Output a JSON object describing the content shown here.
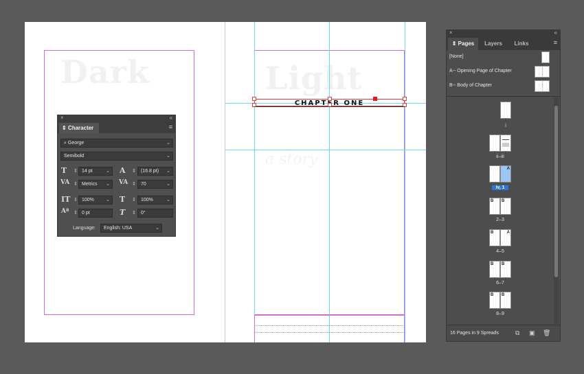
{
  "document": {
    "frame_text": "CHAPTER ONE",
    "ghost_heading_left": "Dark",
    "ghost_heading_right": "Light",
    "ghost_subheading": "a story"
  },
  "character_panel": {
    "tab_label": "Character",
    "font_family": "George",
    "font_style": "Semibold",
    "font_size": "14 pt",
    "leading": "(16.8 pt)",
    "kerning": "Metrics",
    "tracking": "70",
    "vertical_scale": "100%",
    "horizontal_scale": "100%",
    "baseline_shift": "0 pt",
    "skew": "0°",
    "language_label": "Language:",
    "language_value": "English: USA"
  },
  "pages_panel": {
    "tabs": [
      "Pages",
      "Layers",
      "Links"
    ],
    "masters": [
      {
        "label": "[None]"
      },
      {
        "label": "A-- Opening Page of Chapter"
      },
      {
        "label": "B-- Body of Chapter"
      }
    ],
    "spreads": [
      {
        "label": "i",
        "letters": [
          "",
          ""
        ]
      },
      {
        "label": "ii–iii",
        "letters": [
          "",
          ""
        ]
      },
      {
        "label": "iv, 1",
        "letters": [
          "",
          "A"
        ]
      },
      {
        "label": "2–3",
        "letters": [
          "B",
          "B"
        ]
      },
      {
        "label": "4–5",
        "letters": [
          "B",
          "A"
        ]
      },
      {
        "label": "6–7",
        "letters": [
          "B",
          "B"
        ]
      },
      {
        "label": "8–9",
        "letters": [
          "B",
          "B"
        ]
      }
    ],
    "status": "16 Pages in 9 Spreads"
  },
  "icons": {
    "close": "close-icon",
    "collapse": "collapse-icon",
    "menu": "panel-menu-icon",
    "search": "search-icon",
    "new_page": "new-page-icon",
    "delete": "trash-icon",
    "edit_size": "edit-page-size-icon"
  }
}
